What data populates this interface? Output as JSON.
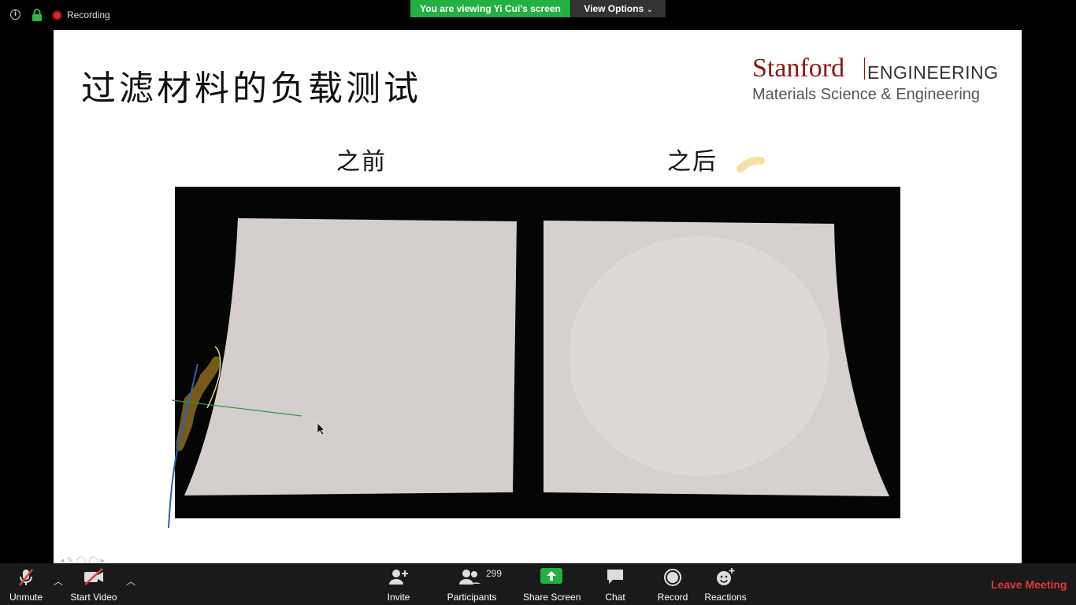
{
  "topbar": {
    "recording_label": "Recording",
    "viewing_label": "You are viewing Yi Cui's screen",
    "view_options_label": "View Options",
    "colors": {
      "viewing_bg": "#23b043",
      "recording_dot": "#e02828"
    }
  },
  "slide": {
    "title": "过滤材料的负载测试",
    "logo": {
      "stanford": "Stanford",
      "engineering": "ENGINEERING",
      "department": "Materials Science & Engineering",
      "brand_color": "#8c1515"
    },
    "caption_before": "之前",
    "caption_after": "之后"
  },
  "bottombar": {
    "unmute_label": "Unmute",
    "start_video_label": "Start Video",
    "invite_label": "Invite",
    "participants_label": "Participants",
    "participants_count": "299",
    "share_screen_label": "Share Screen",
    "chat_label": "Chat",
    "record_label": "Record",
    "reactions_label": "Reactions",
    "leave_label": "Leave Meeting",
    "colors": {
      "share_green": "#23b043",
      "leave_red": "#e03a3a"
    }
  }
}
